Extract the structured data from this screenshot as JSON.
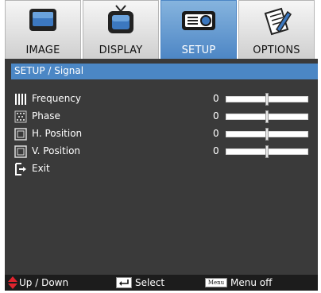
{
  "tabs": [
    {
      "label": "IMAGE",
      "icon": "monitor-icon",
      "active": false
    },
    {
      "label": "DISPLAY",
      "icon": "tv-icon",
      "active": false
    },
    {
      "label": "SETUP",
      "icon": "projector-icon",
      "active": true
    },
    {
      "label": "OPTIONS",
      "icon": "pencil-paper-icon",
      "active": false
    }
  ],
  "panel": {
    "title": "SETUP / Signal",
    "rows": [
      {
        "label": "Frequency",
        "value": "0",
        "icon": "frequency-icon",
        "level": 0.5
      },
      {
        "label": "Phase",
        "value": "0",
        "icon": "phase-icon",
        "level": 0.5
      },
      {
        "label": "H. Position",
        "value": "0",
        "icon": "h-position-icon",
        "level": 0.5
      },
      {
        "label": "V. Position",
        "value": "0",
        "icon": "v-position-icon",
        "level": 0.5
      },
      {
        "label": "Exit",
        "icon": "exit-icon"
      }
    ]
  },
  "footer": {
    "updown": "Up / Down",
    "select": "Select",
    "menu_key": "Menu",
    "menu_off": "Menu off"
  },
  "colors": {
    "accent": "#4b87c5",
    "panel": "#3a3a3a",
    "footer": "#1c1c1c",
    "updown_arrow": "#e0242e"
  }
}
